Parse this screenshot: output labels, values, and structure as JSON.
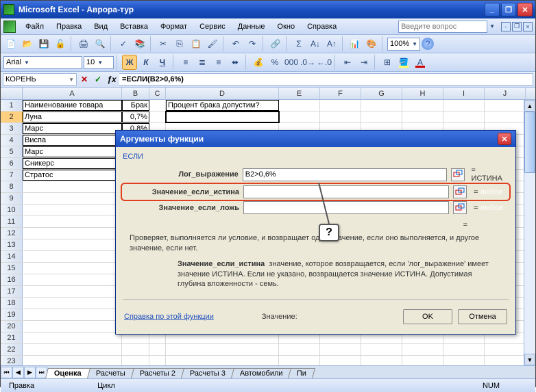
{
  "app": {
    "title": "Microsoft Excel - Аврора-тур"
  },
  "menu": {
    "file": "Файл",
    "edit": "Правка",
    "view": "Вид",
    "insert": "Вставка",
    "format": "Формат",
    "tools": "Сервис",
    "data": "Данные",
    "window": "Окно",
    "help": "Справка",
    "search_placeholder": "Введите вопрос"
  },
  "toolbar": {
    "zoom": "100%"
  },
  "font": {
    "name": "Arial",
    "size": "10"
  },
  "formula": {
    "namebox": "КОРЕНЬ",
    "formula": "=ЕСЛИ(B2>0,6%)"
  },
  "columns": [
    "A",
    "B",
    "C",
    "D",
    "E",
    "F",
    "G",
    "H",
    "I",
    "J"
  ],
  "rows": [
    {
      "n": "1",
      "A": "Наименование товара",
      "B": "Брак",
      "D": "Процент брака допустим?"
    },
    {
      "n": "2",
      "A": "Луна",
      "B": "0,7%"
    },
    {
      "n": "3",
      "A": "Марс",
      "B": "0,8%"
    },
    {
      "n": "4",
      "A": "Виспа",
      "B": ""
    },
    {
      "n": "5",
      "A": "Марс",
      "B": ""
    },
    {
      "n": "6",
      "A": "Сникерс",
      "B": ""
    },
    {
      "n": "7",
      "A": "Стратос",
      "B": ""
    },
    {
      "n": "8"
    },
    {
      "n": "9"
    },
    {
      "n": "10"
    },
    {
      "n": "11"
    },
    {
      "n": "12"
    },
    {
      "n": "13"
    },
    {
      "n": "14"
    },
    {
      "n": "15"
    },
    {
      "n": "16"
    },
    {
      "n": "17"
    },
    {
      "n": "18"
    },
    {
      "n": "19"
    },
    {
      "n": "20"
    },
    {
      "n": "21"
    },
    {
      "n": "22"
    },
    {
      "n": "23"
    }
  ],
  "tabs": {
    "active": "Оценка",
    "others": [
      "Расчеты",
      "Расчеты 2",
      "Расчеты 3",
      "Автомобили",
      "Пи"
    ]
  },
  "status": {
    "left": "Правка",
    "mid": "Цикл",
    "num": "NUM"
  },
  "dialog": {
    "title": "Аргументы функции",
    "func": "ЕСЛИ",
    "arg1_label": "Лог_выражение",
    "arg1_value": "B2>0,6%",
    "arg1_result": "= ИСТИНА",
    "arg2_label": "Значение_если_истина",
    "arg2_value": "",
    "arg2_result_eq": "=",
    "arg2_result_val": "любое",
    "arg3_label": "Значение_если_ложь",
    "arg3_value": "",
    "arg3_result_eq": "=",
    "arg3_result_val": "любое",
    "result_eq": "=",
    "desc": "Проверяет, выполняется ли условие, и возвращает одно значение, если оно выполняется, и другое значение, если нет.",
    "desc2_label": "Значение_если_истина",
    "desc2": "значение, которое возвращается, если 'лог_выражение' имеет значение ИСТИНА. Если не указано, возвращается значение ИСТИНА. Допустимая глубина вложенности - семь.",
    "help": "Справка по этой функции",
    "val_label": "Значение:",
    "ok": "OK",
    "cancel": "Отмена",
    "callout": "?"
  }
}
